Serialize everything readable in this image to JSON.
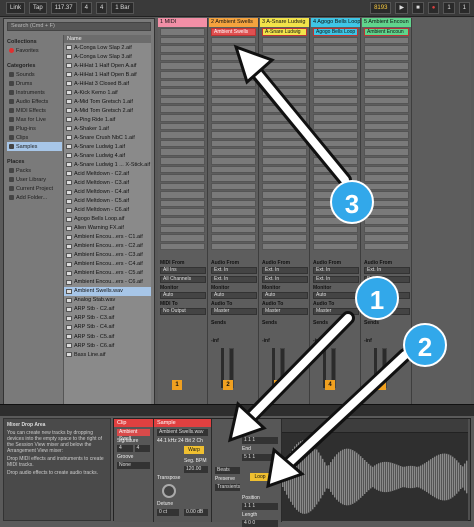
{
  "topbar": {
    "link": "Link",
    "tap": "Tap",
    "tempo": "117.37",
    "meter_num": "4",
    "meter_den": "4",
    "quantize": "1 Bar",
    "position": "8193",
    "loop_start": "1",
    "loop_len": "1"
  },
  "browser": {
    "search_placeholder": "Search (Cmd + F)",
    "collections_label": "Collections",
    "favorites": "Favorites",
    "categories_label": "Categories",
    "categories": [
      "Sounds",
      "Drums",
      "Instruments",
      "Audio Effects",
      "MIDI Effects",
      "Max for Live",
      "Plug-ins",
      "Clips",
      "Samples"
    ],
    "places_label": "Places",
    "places": [
      "Packs",
      "User Library",
      "Current Project",
      "Add Folder..."
    ],
    "name_header": "Name",
    "files": [
      "A-Conga Low Slap 2.aif",
      "A-Conga Low Slap 3.aif",
      "A-HiHat 1 Half Open A.aif",
      "A-HiHat 1 Half Open B.aif",
      "A-HiHat 3 Closed B.aif",
      "A-Kick Kemo 1.aif",
      "A-Mid Tom Gretsch 1.aif",
      "A-Mid Tom Gretsch 2.aif",
      "A-Ping Ride 1.aif",
      "A-Shaker 1.aif",
      "A-Snare Crush NbC 1.aif",
      "A-Snare Ludwig 1.aif",
      "A-Snare Ludwig 4.aif",
      "A-Snare Ludwig 1 ... X-Stick.aif",
      "Acid Meltdown - C2.aif",
      "Acid Meltdown - C3.aif",
      "Acid Meltdown - C4.aif",
      "Acid Meltdown - C5.aif",
      "Acid Meltdown - C6.aif",
      "Agogo Bells Loop.aif",
      "Alien Warning FX.aif",
      "Ambient Encou...ers - C1.aif",
      "Ambient Encou...ers - C2.aif",
      "Ambient Encou...ers - C3.aif",
      "Ambient Encou...ers - C4.aif",
      "Ambient Encou...ers - C5.aif",
      "Ambient Encou...ers - C6.aif",
      "Ambient Swells.wav",
      "Analog Stab.wav",
      "ARP Stb - C2.aif",
      "ARP Stb - C3.aif",
      "ARP Stb - C4.aif",
      "ARP Stb - C5.aif",
      "ARP Stb - C6.aif",
      "Bass Line.aif"
    ],
    "selected_file_index": 27
  },
  "tracks": [
    {
      "name": "1 MIDI",
      "color": "#f28fa6",
      "clip": ""
    },
    {
      "name": "2 Ambient Swells",
      "color": "#f5a33e",
      "clip": "Ambient Swells"
    },
    {
      "name": "3 A-Snare Ludwig",
      "color": "#f2e34a",
      "clip": "A-Snare Ludwig"
    },
    {
      "name": "4 Agogo Bells Loop",
      "color": "#3fc6e6",
      "clip": "Agogo Bells Loop"
    },
    {
      "name": "5 Ambient Encoun",
      "color": "#60d48c",
      "clip": "Ambient Encoun"
    }
  ],
  "mixer": {
    "midi_from": "MIDI From",
    "audio_from": "Audio From",
    "all_ins": "All Ins",
    "ext_in": "Ext. In",
    "all_channels": "All Channels",
    "monitor": "Monitor",
    "in": "In",
    "auto": "Auto",
    "off": "Off",
    "midi_to": "MIDI To",
    "audio_to": "Audio To",
    "no_output": "No Output",
    "master": "Master",
    "sends": "Sends",
    "inf": "-inf",
    "numbers": [
      "1",
      "2",
      "3",
      "4",
      "5"
    ]
  },
  "info_view": {
    "title": "Mixer Drop Area",
    "body": "You can create new tracks by dropping devices into the empty space to the right of the Session View mixer and below the Arrangement View mixer:",
    "bullet1": "Drop MIDI effects and instruments to create MIDI tracks.",
    "bullet2": "Drop audio effects to create audio tracks."
  },
  "clip_view": {
    "clip_header": "Clip",
    "clip_name": "Ambient Swell",
    "signature_label": "Signature",
    "sig_num": "4",
    "sig_den": "4",
    "groove_label": "Groove",
    "groove_value": "None",
    "sample_header": "Sample",
    "sample_name": "Ambient Swells.wav",
    "sample_info": "44.1 kHz 24 Bit 2 Ch",
    "warp": "Warp",
    "seg_bpm": "Seg. BPM",
    "bpm": "120.00",
    "transpose": "Transpose",
    "detune": "Detune",
    "detune_value": "0 ct",
    "volume_value": "0.00 dB",
    "beats": "Beats",
    "preserve": "Preserve",
    "transients": "Transients",
    "start": "Start",
    "end": "End",
    "loop": "Loop",
    "position": "Position",
    "length": "Length",
    "start_value": "1 1 1",
    "end_value": "5 1 1",
    "position_value": "1 1 1",
    "length_value": "4 0 0"
  },
  "annotations": {
    "badge1": "1",
    "badge2": "2",
    "badge3": "3"
  }
}
